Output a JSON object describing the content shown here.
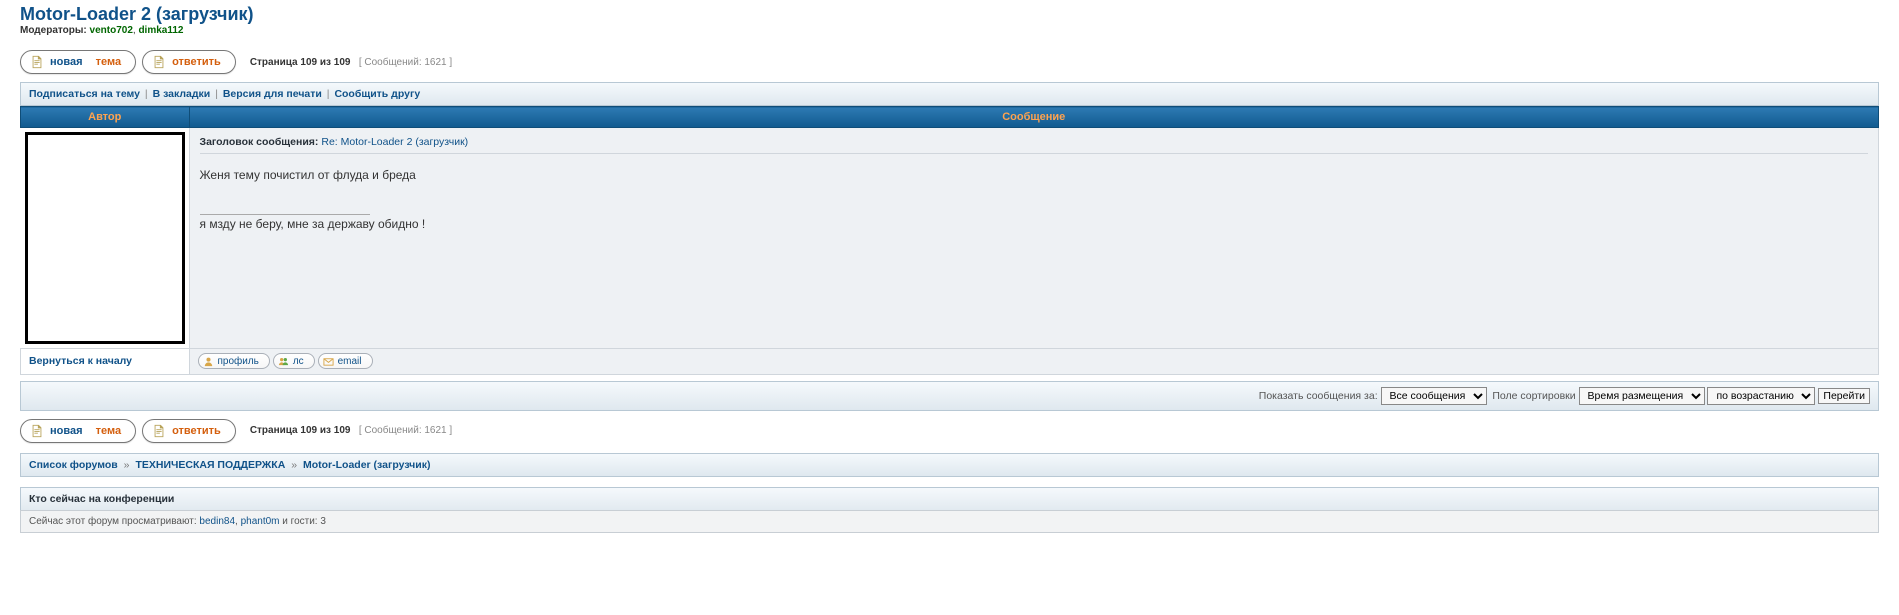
{
  "topic": {
    "title": "Motor-Loader 2 (загрузчик)",
    "moderators_label": "Модераторы:",
    "moderators": [
      "vento702",
      "dimka112"
    ]
  },
  "buttons": {
    "new_topic_primary": "новая",
    "new_topic_accent": "тема",
    "reply_accent": "ответить"
  },
  "pagination": {
    "page_label": "Страница",
    "current": "109",
    "of_label": "из",
    "total_pages": "109",
    "count_prefix": "[ Сообщений:",
    "count": "1621",
    "count_suffix": "]"
  },
  "topic_actions": {
    "subscribe": "Подписаться на тему",
    "bookmark": "В закладки",
    "print": "Версия для печати",
    "email": "Сообщить другу"
  },
  "table_headers": {
    "author": "Автор",
    "message": "Сообщение"
  },
  "post": {
    "subject_label": "Заголовок сообщения:",
    "subject": "Re: Motor-Loader 2 (загрузчик)",
    "body": "Женя тему почистил от флуда и бреда",
    "signature": "я мзду не беру, мне за державу обидно !"
  },
  "back_to_top": "Вернуться к началу",
  "profile_buttons": {
    "profile": "профиль",
    "pm": "лс",
    "email": "email"
  },
  "display_options": {
    "show_label": "Показать сообщения за:",
    "period_selected": "Все сообщения",
    "sort_label": "Поле сортировки",
    "sort_field_selected": "Время размещения",
    "sort_dir_selected": "по возрастанию",
    "go": "Перейти"
  },
  "breadcrumb": {
    "root": "Список форумов",
    "cat": "ТЕХНИЧЕСКАЯ ПОДДЕРЖКА",
    "forum": "Motor-Loader (загрузчик)"
  },
  "who_online": {
    "header": "Кто сейчас на конференции",
    "prefix": "Сейчас этот форум просматривают:",
    "users": [
      "bedin84",
      "phant0m"
    ],
    "guests_label": "и гости:",
    "guests_count": "3"
  }
}
